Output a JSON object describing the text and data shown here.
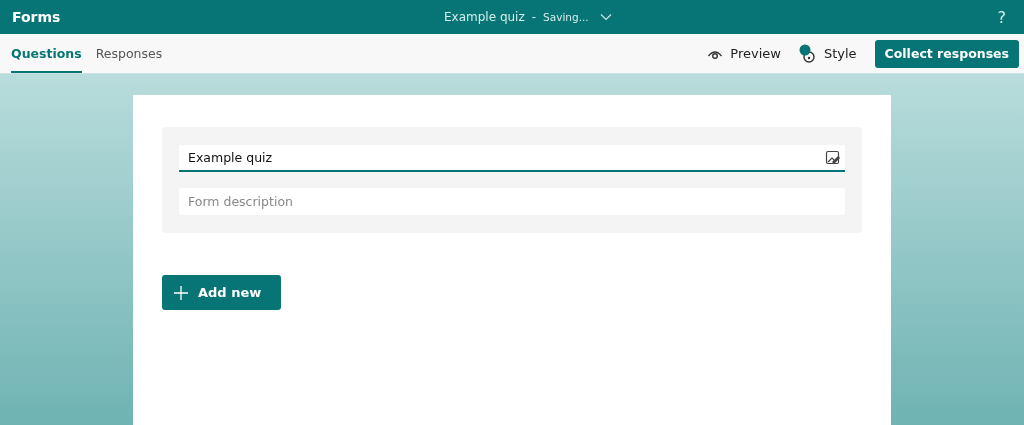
{
  "app": {
    "name": "Forms",
    "form_title": "Example quiz",
    "separator": "-",
    "status": "Saving...",
    "help": "?"
  },
  "tabs": [
    {
      "label": "Questions",
      "selected": true
    },
    {
      "label": "Responses",
      "selected": false
    }
  ],
  "toolbar": {
    "preview": "Preview",
    "style": "Style",
    "collect": "Collect responses"
  },
  "form": {
    "title": "Example quiz",
    "description": {
      "placeholder": "Form description"
    }
  },
  "add_button": "Add new"
}
